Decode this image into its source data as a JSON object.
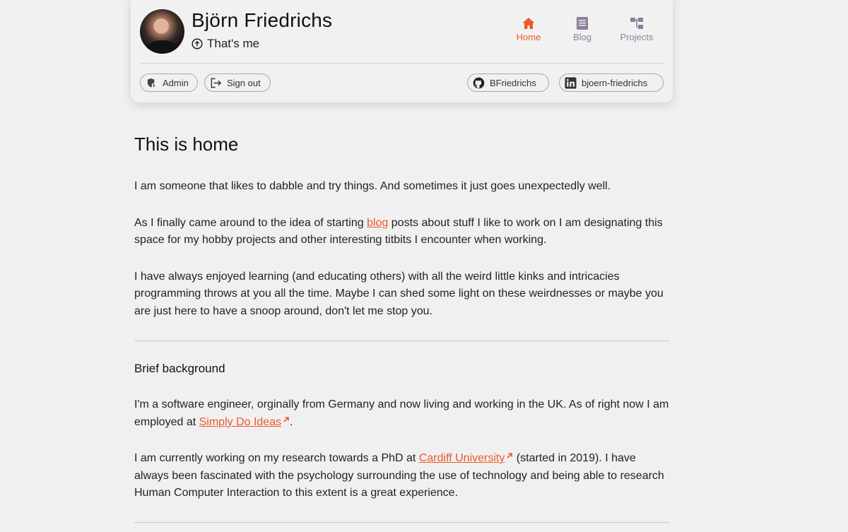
{
  "header": {
    "name": "Björn Friedrichs",
    "tagline": "That's me",
    "nav": [
      {
        "label": "Home",
        "icon": "home-icon",
        "active": true
      },
      {
        "label": "Blog",
        "icon": "blog-icon",
        "active": false
      },
      {
        "label": "Projects",
        "icon": "projects-icon",
        "active": false
      }
    ],
    "actions": {
      "admin_label": "Admin",
      "signout_label": "Sign out",
      "github_label": "BFriedrichs",
      "linkedin_label": "bjoern-friedrichs"
    }
  },
  "main": {
    "title": "This is home",
    "p1": "I am someone that likes to dabble and try things. And sometimes it just goes unexpectedly well.",
    "p2": {
      "before": "As I finally came around to the idea of starting ",
      "link": "blog",
      "after": " posts about stuff I like to work on I am designating this space for my hobby projects and other interesting titbits I encounter when working."
    },
    "p3": "I have always enjoyed learning (and educating others) with all the weird little kinks and intricacies programming throws at you all the time. Maybe I can shed some light on these weirdnesses or maybe you are just here to have a snoop around, don't let me stop you.",
    "background_heading": "Brief background",
    "p4": {
      "before": "I'm a software engineer, orginally from Germany and now living and working in the UK. As of right now I am employed at ",
      "link": "Simply Do Ideas",
      "after": "."
    },
    "p5": {
      "before": "I am currently working on my research towards a PhD at ",
      "link": "Cardiff University",
      "after": " (started in 2019). I have always been fascinated with the psychology surrounding the use of technology and being able to research Human Computer Interaction to this extent is a great experience."
    }
  },
  "colors": {
    "accent": "#ec5a2a",
    "nav_inactive": "#8f7f9a",
    "background": "#f0f0f1"
  }
}
